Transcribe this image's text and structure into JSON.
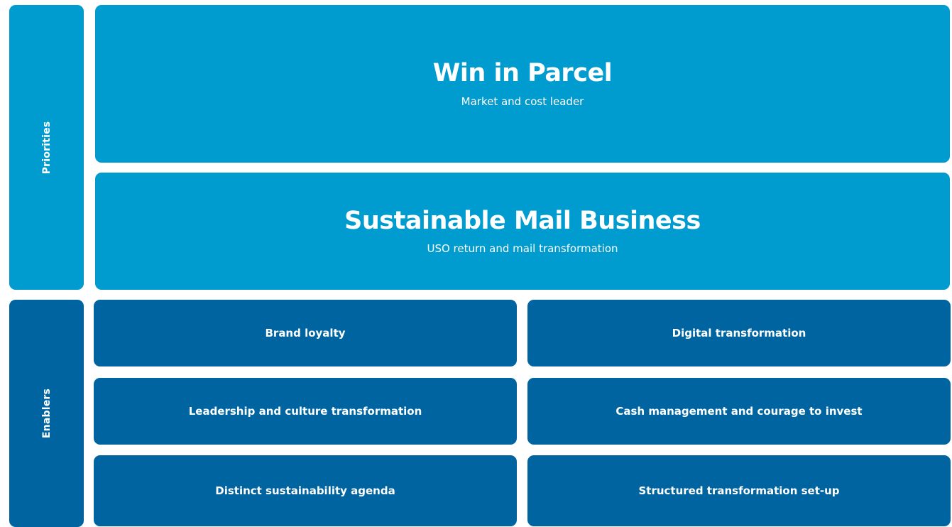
{
  "colors": {
    "priority_fill": "#009bcf",
    "enabler_fill": "#0064a1",
    "text": "#ffffff"
  },
  "side_labels": {
    "priorities": "Priorities",
    "enablers": "Enablers"
  },
  "priorities": [
    {
      "title": "Win in Parcel",
      "subtitle": "Market and cost leader"
    },
    {
      "title": "Sustainable Mail Business",
      "subtitle": "USO return and mail transformation"
    }
  ],
  "enablers": [
    "Brand loyalty",
    "Digital transformation",
    "Leadership and culture transformation",
    "Cash management and courage to invest",
    "Distinct sustainability agenda",
    "Structured transformation set-up"
  ]
}
